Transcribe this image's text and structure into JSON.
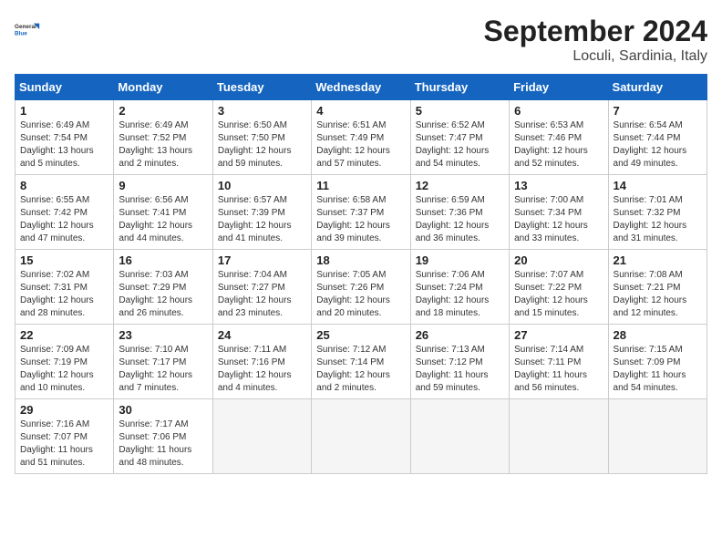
{
  "header": {
    "logo_line1": "General",
    "logo_line2": "Blue",
    "month_title": "September 2024",
    "location": "Loculi, Sardinia, Italy"
  },
  "weekdays": [
    "Sunday",
    "Monday",
    "Tuesday",
    "Wednesday",
    "Thursday",
    "Friday",
    "Saturday"
  ],
  "weeks": [
    [
      {
        "day": "1",
        "info": "Sunrise: 6:49 AM\nSunset: 7:54 PM\nDaylight: 13 hours\nand 5 minutes."
      },
      {
        "day": "2",
        "info": "Sunrise: 6:49 AM\nSunset: 7:52 PM\nDaylight: 13 hours\nand 2 minutes."
      },
      {
        "day": "3",
        "info": "Sunrise: 6:50 AM\nSunset: 7:50 PM\nDaylight: 12 hours\nand 59 minutes."
      },
      {
        "day": "4",
        "info": "Sunrise: 6:51 AM\nSunset: 7:49 PM\nDaylight: 12 hours\nand 57 minutes."
      },
      {
        "day": "5",
        "info": "Sunrise: 6:52 AM\nSunset: 7:47 PM\nDaylight: 12 hours\nand 54 minutes."
      },
      {
        "day": "6",
        "info": "Sunrise: 6:53 AM\nSunset: 7:46 PM\nDaylight: 12 hours\nand 52 minutes."
      },
      {
        "day": "7",
        "info": "Sunrise: 6:54 AM\nSunset: 7:44 PM\nDaylight: 12 hours\nand 49 minutes."
      }
    ],
    [
      {
        "day": "8",
        "info": "Sunrise: 6:55 AM\nSunset: 7:42 PM\nDaylight: 12 hours\nand 47 minutes."
      },
      {
        "day": "9",
        "info": "Sunrise: 6:56 AM\nSunset: 7:41 PM\nDaylight: 12 hours\nand 44 minutes."
      },
      {
        "day": "10",
        "info": "Sunrise: 6:57 AM\nSunset: 7:39 PM\nDaylight: 12 hours\nand 41 minutes."
      },
      {
        "day": "11",
        "info": "Sunrise: 6:58 AM\nSunset: 7:37 PM\nDaylight: 12 hours\nand 39 minutes."
      },
      {
        "day": "12",
        "info": "Sunrise: 6:59 AM\nSunset: 7:36 PM\nDaylight: 12 hours\nand 36 minutes."
      },
      {
        "day": "13",
        "info": "Sunrise: 7:00 AM\nSunset: 7:34 PM\nDaylight: 12 hours\nand 33 minutes."
      },
      {
        "day": "14",
        "info": "Sunrise: 7:01 AM\nSunset: 7:32 PM\nDaylight: 12 hours\nand 31 minutes."
      }
    ],
    [
      {
        "day": "15",
        "info": "Sunrise: 7:02 AM\nSunset: 7:31 PM\nDaylight: 12 hours\nand 28 minutes."
      },
      {
        "day": "16",
        "info": "Sunrise: 7:03 AM\nSunset: 7:29 PM\nDaylight: 12 hours\nand 26 minutes."
      },
      {
        "day": "17",
        "info": "Sunrise: 7:04 AM\nSunset: 7:27 PM\nDaylight: 12 hours\nand 23 minutes."
      },
      {
        "day": "18",
        "info": "Sunrise: 7:05 AM\nSunset: 7:26 PM\nDaylight: 12 hours\nand 20 minutes."
      },
      {
        "day": "19",
        "info": "Sunrise: 7:06 AM\nSunset: 7:24 PM\nDaylight: 12 hours\nand 18 minutes."
      },
      {
        "day": "20",
        "info": "Sunrise: 7:07 AM\nSunset: 7:22 PM\nDaylight: 12 hours\nand 15 minutes."
      },
      {
        "day": "21",
        "info": "Sunrise: 7:08 AM\nSunset: 7:21 PM\nDaylight: 12 hours\nand 12 minutes."
      }
    ],
    [
      {
        "day": "22",
        "info": "Sunrise: 7:09 AM\nSunset: 7:19 PM\nDaylight: 12 hours\nand 10 minutes."
      },
      {
        "day": "23",
        "info": "Sunrise: 7:10 AM\nSunset: 7:17 PM\nDaylight: 12 hours\nand 7 minutes."
      },
      {
        "day": "24",
        "info": "Sunrise: 7:11 AM\nSunset: 7:16 PM\nDaylight: 12 hours\nand 4 minutes."
      },
      {
        "day": "25",
        "info": "Sunrise: 7:12 AM\nSunset: 7:14 PM\nDaylight: 12 hours\nand 2 minutes."
      },
      {
        "day": "26",
        "info": "Sunrise: 7:13 AM\nSunset: 7:12 PM\nDaylight: 11 hours\nand 59 minutes."
      },
      {
        "day": "27",
        "info": "Sunrise: 7:14 AM\nSunset: 7:11 PM\nDaylight: 11 hours\nand 56 minutes."
      },
      {
        "day": "28",
        "info": "Sunrise: 7:15 AM\nSunset: 7:09 PM\nDaylight: 11 hours\nand 54 minutes."
      }
    ],
    [
      {
        "day": "29",
        "info": "Sunrise: 7:16 AM\nSunset: 7:07 PM\nDaylight: 11 hours\nand 51 minutes."
      },
      {
        "day": "30",
        "info": "Sunrise: 7:17 AM\nSunset: 7:06 PM\nDaylight: 11 hours\nand 48 minutes."
      },
      {
        "day": "",
        "info": ""
      },
      {
        "day": "",
        "info": ""
      },
      {
        "day": "",
        "info": ""
      },
      {
        "day": "",
        "info": ""
      },
      {
        "day": "",
        "info": ""
      }
    ]
  ]
}
